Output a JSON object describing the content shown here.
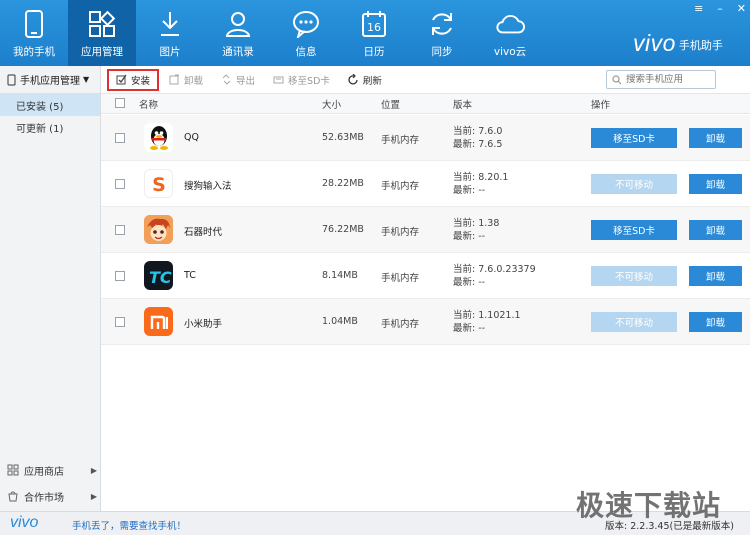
{
  "nav": {
    "items": [
      {
        "label": "我的手机",
        "icon": "phone-icon",
        "active": false
      },
      {
        "label": "应用管理",
        "icon": "apps-grid-icon",
        "active": true
      },
      {
        "label": "图片",
        "icon": "download-arrow-icon",
        "active": false
      },
      {
        "label": "通讯录",
        "icon": "contact-person-icon",
        "active": false
      },
      {
        "label": "信息",
        "icon": "message-bubble-icon",
        "active": false
      },
      {
        "label": "日历",
        "icon": "calendar-icon",
        "active": false,
        "badge": "16"
      },
      {
        "label": "同步",
        "icon": "sync-icon",
        "active": false
      },
      {
        "label": "vivo云",
        "icon": "cloud-icon",
        "active": false
      }
    ]
  },
  "brand": {
    "logo": "vivo",
    "subtitle": "手机助手"
  },
  "window_controls": {
    "menu": "≡",
    "minimize": "–",
    "close": "✕"
  },
  "sidebar": {
    "header": "手机应用管理",
    "items": [
      {
        "label": "已安装 (5)",
        "active": true
      },
      {
        "label": "可更新 (1)",
        "active": false
      }
    ],
    "bottom": [
      {
        "label": "应用商店",
        "icon": "store-icon"
      },
      {
        "label": "合作市场",
        "icon": "market-bag-icon"
      }
    ]
  },
  "toolbar": {
    "install": "安装",
    "uninstall": "卸载",
    "export": "导出",
    "move_to_sd": "移至SD卡",
    "refresh": "刷新",
    "search_placeholder": "搜索手机应用"
  },
  "table": {
    "headers": {
      "name": "名称",
      "size": "大小",
      "location": "位置",
      "version": "版本",
      "action": "操作"
    },
    "rows": [
      {
        "name": "QQ",
        "size": "52.63MB",
        "location": "手机内存",
        "current": "当前: 7.6.0",
        "latest": "最新: 7.6.5",
        "move": "移至SD卡",
        "move_enabled": true,
        "uninstall": "卸载",
        "icon": "qq-penguin-icon"
      },
      {
        "name": "搜狗输入法",
        "size": "28.22MB",
        "location": "手机内存",
        "current": "当前: 8.20.1",
        "latest": "最新: --",
        "move": "不可移动",
        "move_enabled": false,
        "uninstall": "卸载",
        "icon": "sogou-s-icon"
      },
      {
        "name": "石器时代",
        "size": "76.22MB",
        "location": "手机内存",
        "current": "当前: 1.38",
        "latest": "最新: --",
        "move": "移至SD卡",
        "move_enabled": true,
        "uninstall": "卸载",
        "icon": "game-character-icon"
      },
      {
        "name": "TC",
        "size": "8.14MB",
        "location": "手机内存",
        "current": "当前: 7.6.0.23379",
        "latest": "最新: --",
        "move": "不可移动",
        "move_enabled": false,
        "uninstall": "卸载",
        "icon": "tc-logo-icon"
      },
      {
        "name": "小米助手",
        "size": "1.04MB",
        "location": "手机内存",
        "current": "当前: 1.1021.1",
        "latest": "最新: --",
        "move": "不可移动",
        "move_enabled": false,
        "uninstall": "卸载",
        "icon": "mi-logo-icon"
      }
    ]
  },
  "footer": {
    "logo": "vivo",
    "link": "手机丢了，需要查找手机！",
    "version": "版本: 2.2.3.45(已是最新版本)"
  },
  "watermark": "极速下载站",
  "colors": {
    "accent": "#1d7fcb",
    "button": "#2b8ad8",
    "button_disabled": "#b5d6f0",
    "highlight": "#e03030"
  }
}
